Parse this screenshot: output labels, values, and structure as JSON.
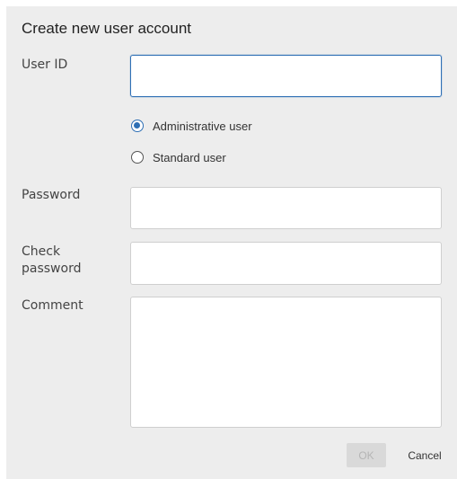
{
  "dialog": {
    "title": "Create new user account",
    "user_id": {
      "label": "User ID",
      "value": ""
    },
    "user_type": {
      "options": [
        {
          "label": "Administrative user",
          "checked": true
        },
        {
          "label": "Standard user",
          "checked": false
        }
      ]
    },
    "password": {
      "label": "Password",
      "value": ""
    },
    "check_password": {
      "label_line1": "Check",
      "label_line2": "password",
      "value": ""
    },
    "comment": {
      "label": "Comment",
      "value": ""
    },
    "buttons": {
      "ok": "OK",
      "cancel": "Cancel",
      "ok_disabled": true
    }
  },
  "colors": {
    "accent": "#2e6fb5",
    "dialog_bg": "#ededed",
    "disabled_button_bg": "#d9d9d9"
  }
}
